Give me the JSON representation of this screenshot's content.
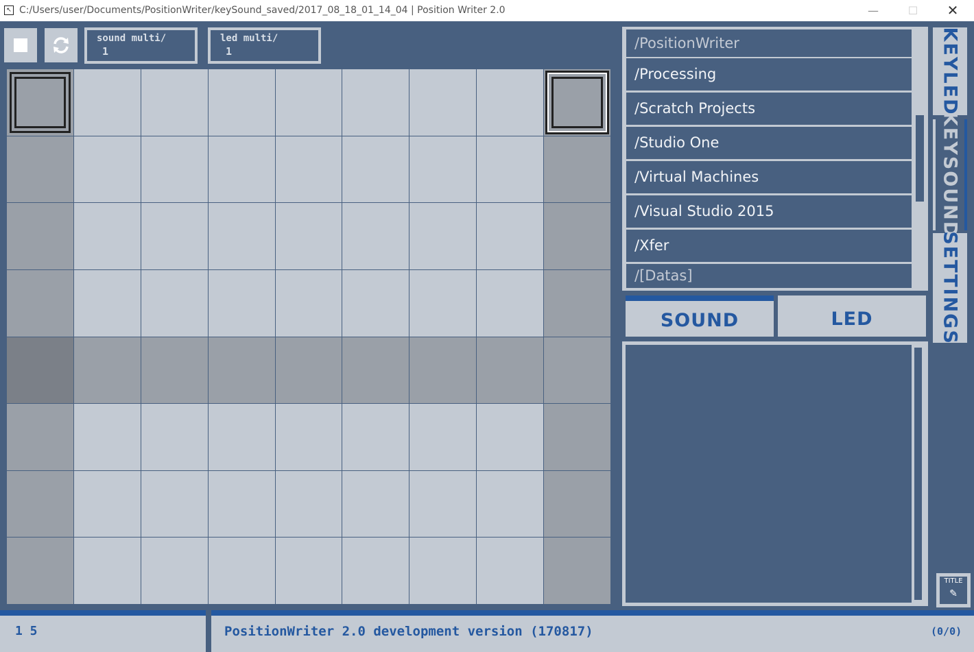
{
  "window": {
    "title": "C:/Users/user/Documents/PositionWriter/keySound_saved/2017_08_18_01_14_04 | Position Writer 2.0",
    "minimize": "—",
    "maximize": "☐",
    "close": "✕"
  },
  "toolbar": {
    "sound_multi_label": "sound multi/",
    "sound_multi_value": "1",
    "led_multi_label": "led multi/",
    "led_multi_value": "1",
    "reload_glyph": "⟳"
  },
  "files": [
    {
      "name": "/PositionWriter"
    },
    {
      "name": "/Processing"
    },
    {
      "name": "/Scratch Projects"
    },
    {
      "name": "/Studio One"
    },
    {
      "name": "/Virtual Machines"
    },
    {
      "name": "/Visual Studio 2015"
    },
    {
      "name": "/Xfer"
    },
    {
      "name": "/[Datas]"
    }
  ],
  "tabs": {
    "sound": "SOUND",
    "led": "LED"
  },
  "side_tabs": {
    "keyled": "KEYLED",
    "keysound": "KEYSOUND",
    "settings": "SETTINGS"
  },
  "title_button": {
    "label": "TITLE",
    "glyph": "✎"
  },
  "status": {
    "position": "1 5",
    "message": "PositionWriter 2.0 development version (170817)",
    "count": "(0/0)"
  },
  "colors": {
    "background": "#486080",
    "panel": "#c3cad3",
    "accent": "#2458a0"
  }
}
